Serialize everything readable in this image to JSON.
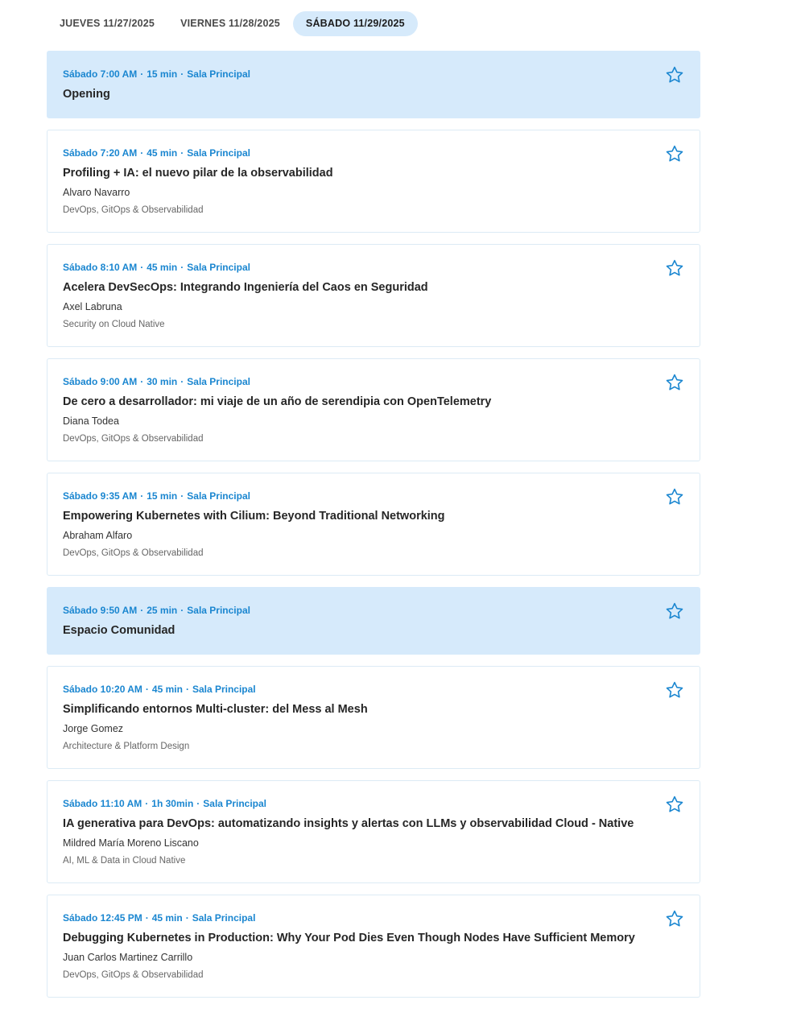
{
  "tabs": [
    {
      "label": "JUEVES 11/27/2025",
      "active": false
    },
    {
      "label": "VIERNES 11/28/2025",
      "active": false
    },
    {
      "label": "SÁBADO 11/29/2025",
      "active": true
    }
  ],
  "colors": {
    "accent": "#1a86d0",
    "highlight_bg": "#d6eafb",
    "card_border": "#dcebf5"
  },
  "sessions": [
    {
      "type": "break",
      "time": "Sábado 7:00 AM",
      "duration": "15 min",
      "room": "Sala Principal",
      "title": "Opening",
      "speaker": "",
      "track": "",
      "icon": "star-outline-icon"
    },
    {
      "type": "talk",
      "time": "Sábado 7:20 AM",
      "duration": "45 min",
      "room": "Sala Principal",
      "title": "Profiling + IA: el nuevo pilar de la observabilidad",
      "speaker": "Alvaro Navarro",
      "track": "DevOps, GitOps & Observabilidad",
      "icon": "star-outline-icon"
    },
    {
      "type": "talk",
      "time": "Sábado 8:10 AM",
      "duration": "45 min",
      "room": "Sala Principal",
      "title": "Acelera DevSecOps: Integrando Ingeniería del Caos en Seguridad",
      "speaker": "Axel Labruna",
      "track": "Security on Cloud Native",
      "icon": "star-outline-icon"
    },
    {
      "type": "talk",
      "time": "Sábado 9:00 AM",
      "duration": "30 min",
      "room": "Sala Principal",
      "title": "De cero a desarrollador: mi viaje de un año de serendipia con OpenTelemetry",
      "speaker": "Diana Todea",
      "track": "DevOps, GitOps & Observabilidad",
      "icon": "star-outline-icon"
    },
    {
      "type": "talk",
      "time": "Sábado 9:35 AM",
      "duration": "15 min",
      "room": "Sala Principal",
      "title": "Empowering Kubernetes with Cilium: Beyond Traditional Networking",
      "speaker": "Abraham Alfaro",
      "track": "DevOps, GitOps & Observabilidad",
      "icon": "star-outline-icon"
    },
    {
      "type": "break",
      "time": "Sábado 9:50 AM",
      "duration": "25 min",
      "room": "Sala Principal",
      "title": "Espacio Comunidad",
      "speaker": "",
      "track": "",
      "icon": "star-outline-icon"
    },
    {
      "type": "talk",
      "time": "Sábado 10:20 AM",
      "duration": "45 min",
      "room": "Sala Principal",
      "title": "Simplificando entornos Multi-cluster: del Mess al Mesh",
      "speaker": "Jorge Gomez",
      "track": "Architecture & Platform Design",
      "icon": "star-outline-icon"
    },
    {
      "type": "talk",
      "time": "Sábado 11:10 AM",
      "duration": "1h 30min",
      "room": "Sala Principal",
      "title": "IA generativa para DevOps: automatizando insights y alertas con LLMs y observabilidad Cloud - Native",
      "speaker": "Mildred María Moreno Liscano",
      "track": "AI, ML & Data in Cloud Native",
      "icon": "star-outline-icon"
    },
    {
      "type": "talk",
      "time": "Sábado 12:45 PM",
      "duration": "45 min",
      "room": "Sala Principal",
      "title": "Debugging Kubernetes in Production: Why Your Pod Dies Even Though Nodes Have Sufficient Memory",
      "speaker": "Juan Carlos Martinez Carrillo",
      "track": "DevOps, GitOps & Observabilidad",
      "icon": "star-outline-icon"
    }
  ]
}
